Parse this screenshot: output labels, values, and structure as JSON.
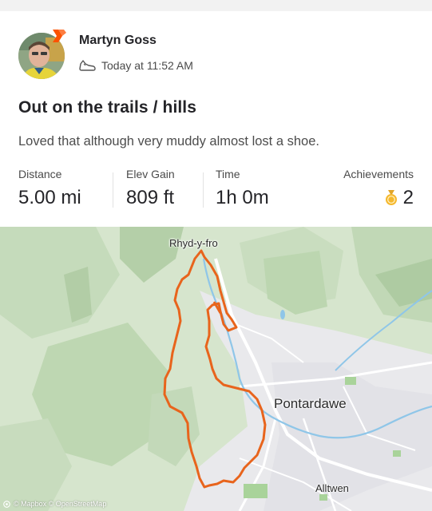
{
  "athlete": {
    "name": "Martyn Goss"
  },
  "activity": {
    "timestamp": "Today at 11:52 AM",
    "title": "Out on the trails / hills",
    "description": "Loved that although very muddy almost lost a shoe.",
    "type_icon": "shoe-icon"
  },
  "stats": {
    "distance": {
      "label": "Distance",
      "value": "5.00 mi"
    },
    "elevation": {
      "label": "Elev Gain",
      "value": "809 ft"
    },
    "time": {
      "label": "Time",
      "value": "1h 0m"
    },
    "achievements": {
      "label": "Achievements",
      "value": "2",
      "icon": "medal-icon"
    }
  },
  "map": {
    "places": [
      "Rhyd-y-fro",
      "Pontardawe",
      "Alltwen"
    ],
    "attribution": "© Mapbox © OpenStreetMap",
    "route_color": "#e8641c"
  },
  "colors": {
    "brand": "#fc5200",
    "route": "#e8641c",
    "medal": "#f5b82e"
  }
}
